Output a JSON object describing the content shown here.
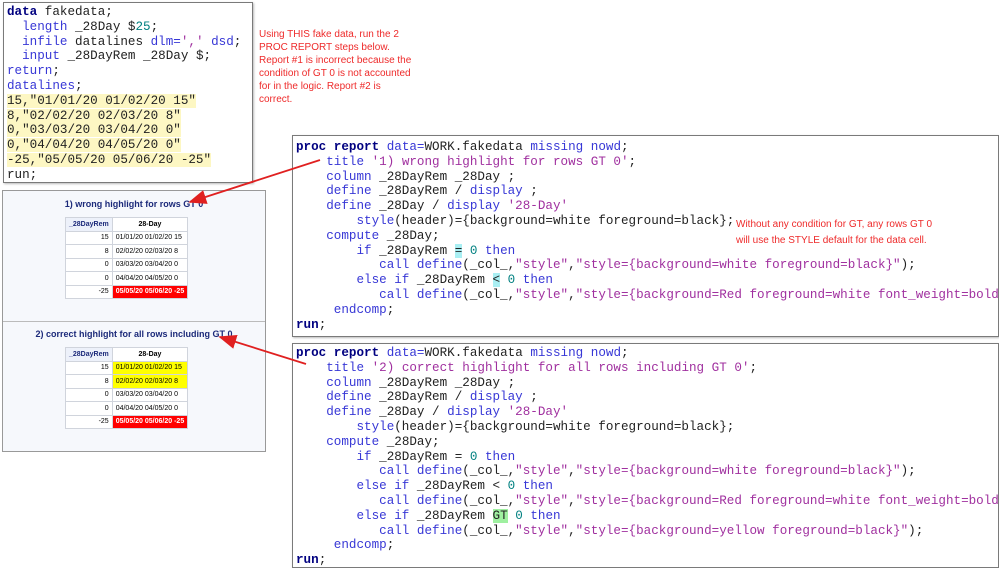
{
  "data_step": {
    "lines": [
      {
        "hl": false,
        "tokens": [
          {
            "t": "data",
            "c": "k"
          },
          {
            "t": " fakedata;",
            "c": "t"
          }
        ]
      },
      {
        "hl": false,
        "tokens": [
          {
            "t": "  length",
            "c": "b"
          },
          {
            "t": " _28Day $",
            "c": "t"
          },
          {
            "t": "25",
            "c": "n"
          },
          {
            "t": ";",
            "c": "t"
          }
        ]
      },
      {
        "hl": false,
        "tokens": [
          {
            "t": "  infile",
            "c": "b"
          },
          {
            "t": " datalines ",
            "c": "t"
          },
          {
            "t": "dlm=",
            "c": "b"
          },
          {
            "t": "','",
            "c": "s"
          },
          {
            "t": " dsd",
            "c": "b"
          },
          {
            "t": ";",
            "c": "t"
          }
        ]
      },
      {
        "hl": false,
        "tokens": [
          {
            "t": "  input",
            "c": "b"
          },
          {
            "t": " _28DayRem _28Day $;",
            "c": "t"
          }
        ]
      },
      {
        "hl": false,
        "tokens": [
          {
            "t": "return",
            "c": "b"
          },
          {
            "t": ";",
            "c": "t"
          }
        ]
      },
      {
        "hl": false,
        "tokens": [
          {
            "t": "datalines",
            "c": "b"
          },
          {
            "t": ";",
            "c": "t"
          }
        ]
      },
      {
        "hl": true,
        "tokens": [
          {
            "t": "15,\"01/01/20 01/02/20 15\"",
            "c": "t"
          }
        ]
      },
      {
        "hl": true,
        "tokens": [
          {
            "t": "8,\"02/02/20 02/03/20 8\"",
            "c": "t"
          }
        ]
      },
      {
        "hl": true,
        "tokens": [
          {
            "t": "0,\"03/03/20 03/04/20 0\"",
            "c": "t"
          }
        ]
      },
      {
        "hl": true,
        "tokens": [
          {
            "t": "0,\"04/04/20 04/05/20 0\"",
            "c": "t"
          }
        ]
      },
      {
        "hl": true,
        "tokens": [
          {
            "t": "-25,\"05/05/20 05/06/20 -25\"",
            "c": "t"
          }
        ]
      },
      {
        "hl": false,
        "tokens": [
          {
            "t": "run;",
            "c": "t"
          }
        ]
      }
    ]
  },
  "proc1": {
    "lines": [
      {
        "tokens": [
          {
            "t": "proc report",
            "c": "k"
          },
          {
            "t": " data=",
            "c": "b"
          },
          {
            "t": "WORK.fakedata ",
            "c": "t"
          },
          {
            "t": "missing nowd",
            "c": "b"
          },
          {
            "t": ";",
            "c": "t"
          }
        ]
      },
      {
        "tokens": [
          {
            "t": "    title",
            "c": "b"
          },
          {
            "t": " '1) wrong highlight for rows GT 0'",
            "c": "s"
          },
          {
            "t": ";",
            "c": "t"
          }
        ]
      },
      {
        "tokens": [
          {
            "t": "    column",
            "c": "b"
          },
          {
            "t": " _28DayRem _28Day ;",
            "c": "t"
          }
        ]
      },
      {
        "tokens": [
          {
            "t": "    define",
            "c": "b"
          },
          {
            "t": " _28DayRem / ",
            "c": "t"
          },
          {
            "t": "display",
            "c": "b"
          },
          {
            "t": " ;",
            "c": "t"
          }
        ]
      },
      {
        "tokens": [
          {
            "t": "    define",
            "c": "b"
          },
          {
            "t": " _28Day / ",
            "c": "t"
          },
          {
            "t": "display",
            "c": "b"
          },
          {
            "t": " '28-Day'",
            "c": "s"
          }
        ]
      },
      {
        "tokens": [
          {
            "t": "        style",
            "c": "b"
          },
          {
            "t": "(header)={background=white foreground=black};",
            "c": "t"
          }
        ]
      },
      {
        "tokens": [
          {
            "t": "    compute",
            "c": "b"
          },
          {
            "t": " _28Day;",
            "c": "t"
          }
        ]
      },
      {
        "tokens": [
          {
            "t": "        if",
            "c": "b"
          },
          {
            "t": " _28DayRem ",
            "c": "t"
          },
          {
            "t": "=",
            "c": "hc"
          },
          {
            "t": " ",
            "c": "t"
          },
          {
            "t": "0",
            "c": "n"
          },
          {
            "t": " then",
            "c": "b"
          }
        ]
      },
      {
        "tokens": [
          {
            "t": "           call define",
            "c": "b"
          },
          {
            "t": "(_col_,",
            "c": "t"
          },
          {
            "t": "\"style\"",
            "c": "s"
          },
          {
            "t": ",",
            "c": "t"
          },
          {
            "t": "\"style={background=white foreground=black}\"",
            "c": "s"
          },
          {
            "t": ");",
            "c": "t"
          }
        ]
      },
      {
        "tokens": [
          {
            "t": "        else if",
            "c": "b"
          },
          {
            "t": " _28DayRem ",
            "c": "t"
          },
          {
            "t": "<",
            "c": "hc"
          },
          {
            "t": " ",
            "c": "t"
          },
          {
            "t": "0",
            "c": "n"
          },
          {
            "t": " then",
            "c": "b"
          }
        ]
      },
      {
        "tokens": [
          {
            "t": "           call define",
            "c": "b"
          },
          {
            "t": "(_col_,",
            "c": "t"
          },
          {
            "t": "\"style\"",
            "c": "s"
          },
          {
            "t": ",",
            "c": "t"
          },
          {
            "t": "\"style={background=Red foreground=white font_weight=bold}\"",
            "c": "s"
          },
          {
            "t": ");",
            "c": "t"
          }
        ]
      },
      {
        "tokens": [
          {
            "t": "     endcomp",
            "c": "b"
          },
          {
            "t": ";",
            "c": "t"
          }
        ]
      },
      {
        "tokens": [
          {
            "t": "run",
            "c": "k"
          },
          {
            "t": ";",
            "c": "t"
          }
        ]
      }
    ]
  },
  "proc2": {
    "lines": [
      {
        "tokens": [
          {
            "t": "proc report",
            "c": "k"
          },
          {
            "t": " data=",
            "c": "b"
          },
          {
            "t": "WORK.fakedata ",
            "c": "t"
          },
          {
            "t": "missing nowd",
            "c": "b"
          },
          {
            "t": ";",
            "c": "t"
          }
        ]
      },
      {
        "tokens": [
          {
            "t": "    title",
            "c": "b"
          },
          {
            "t": " '2) correct highlight for all rows including GT 0'",
            "c": "s"
          },
          {
            "t": ";",
            "c": "t"
          }
        ]
      },
      {
        "tokens": [
          {
            "t": "    column",
            "c": "b"
          },
          {
            "t": " _28DayRem _28Day ;",
            "c": "t"
          }
        ]
      },
      {
        "tokens": [
          {
            "t": "    define",
            "c": "b"
          },
          {
            "t": " _28DayRem / ",
            "c": "t"
          },
          {
            "t": "display",
            "c": "b"
          },
          {
            "t": " ;",
            "c": "t"
          }
        ]
      },
      {
        "tokens": [
          {
            "t": "    define",
            "c": "b"
          },
          {
            "t": " _28Day / ",
            "c": "t"
          },
          {
            "t": "display",
            "c": "b"
          },
          {
            "t": " '28-Day'",
            "c": "s"
          }
        ]
      },
      {
        "tokens": [
          {
            "t": "        style",
            "c": "b"
          },
          {
            "t": "(header)={background=white foreground=black};",
            "c": "t"
          }
        ]
      },
      {
        "tokens": [
          {
            "t": "    compute",
            "c": "b"
          },
          {
            "t": " _28Day;",
            "c": "t"
          }
        ]
      },
      {
        "tokens": [
          {
            "t": "        if",
            "c": "b"
          },
          {
            "t": " _28DayRem = ",
            "c": "t"
          },
          {
            "t": "0",
            "c": "n"
          },
          {
            "t": " then",
            "c": "b"
          }
        ]
      },
      {
        "tokens": [
          {
            "t": "           call define",
            "c": "b"
          },
          {
            "t": "(_col_,",
            "c": "t"
          },
          {
            "t": "\"style\"",
            "c": "s"
          },
          {
            "t": ",",
            "c": "t"
          },
          {
            "t": "\"style={background=white foreground=black}\"",
            "c": "s"
          },
          {
            "t": ");",
            "c": "t"
          }
        ]
      },
      {
        "tokens": [
          {
            "t": "        else if",
            "c": "b"
          },
          {
            "t": " _28DayRem < ",
            "c": "t"
          },
          {
            "t": "0",
            "c": "n"
          },
          {
            "t": " then",
            "c": "b"
          }
        ]
      },
      {
        "tokens": [
          {
            "t": "           call define",
            "c": "b"
          },
          {
            "t": "(_col_,",
            "c": "t"
          },
          {
            "t": "\"style\"",
            "c": "s"
          },
          {
            "t": ",",
            "c": "t"
          },
          {
            "t": "\"style={background=Red foreground=white font_weight=bold}\"",
            "c": "s"
          },
          {
            "t": ");",
            "c": "t"
          }
        ]
      },
      {
        "tokens": [
          {
            "t": "        else if",
            "c": "b"
          },
          {
            "t": " _28DayRem ",
            "c": "t"
          },
          {
            "t": "GT",
            "c": "hg"
          },
          {
            "t": " ",
            "c": "t"
          },
          {
            "t": "0",
            "c": "n"
          },
          {
            "t": " then",
            "c": "b"
          }
        ]
      },
      {
        "tokens": [
          {
            "t": "           call define",
            "c": "b"
          },
          {
            "t": "(_col_,",
            "c": "t"
          },
          {
            "t": "\"style\"",
            "c": "s"
          },
          {
            "t": ",",
            "c": "t"
          },
          {
            "t": "\"style={background=yellow foreground=black}\"",
            "c": "s"
          },
          {
            "t": ");",
            "c": "t"
          }
        ]
      },
      {
        "tokens": [
          {
            "t": "     endcomp",
            "c": "b"
          },
          {
            "t": ";",
            "c": "t"
          }
        ]
      },
      {
        "tokens": [
          {
            "t": "run",
            "c": "k"
          },
          {
            "t": ";",
            "c": "t"
          }
        ]
      }
    ]
  },
  "notes": {
    "top": [
      "Using THIS fake data, run the 2",
      "PROC REPORT steps below.",
      "Report #1 is incorrect because the",
      "condition of GT 0 is not accounted",
      "for in the logic. Report #2 is",
      "correct."
    ],
    "right": [
      "Without any condition for GT, any rows GT 0",
      "will use the STYLE default for the data cell."
    ]
  },
  "reports": [
    {
      "title": "1) wrong highlight for rows GT 0",
      "headers": [
        "_28DayRem",
        "28-Day"
      ],
      "rows": [
        {
          "rem": "15",
          "day": "01/01/20 01/02/20 15",
          "style": ""
        },
        {
          "rem": "8",
          "day": "02/02/20 02/03/20 8",
          "style": ""
        },
        {
          "rem": "0",
          "day": "03/03/20 03/04/20 0",
          "style": ""
        },
        {
          "rem": "0",
          "day": "04/04/20 04/05/20 0",
          "style": ""
        },
        {
          "rem": "-25",
          "day": "05/05/20 05/06/20 -25",
          "style": "red"
        }
      ]
    },
    {
      "title": "2) correct highlight for all rows including GT 0",
      "headers": [
        "_28DayRem",
        "28-Day"
      ],
      "rows": [
        {
          "rem": "15",
          "day": "01/01/20 01/02/20 15",
          "style": "yellow"
        },
        {
          "rem": "8",
          "day": "02/02/20 02/03/20 8",
          "style": "yellow"
        },
        {
          "rem": "0",
          "day": "03/03/20 03/04/20 0",
          "style": ""
        },
        {
          "rem": "0",
          "day": "04/04/20 04/05/20 0",
          "style": ""
        },
        {
          "rem": "-25",
          "day": "05/05/20 05/06/20 -25",
          "style": "red"
        }
      ]
    }
  ],
  "colors": {
    "note": "#ee2a2a",
    "arrow": "#e02020",
    "red_cell": "#ff0000",
    "yellow_cell": "#ffff00",
    "highlight_cyan": "#a9eff3",
    "highlight_green": "#9ff0a0"
  }
}
